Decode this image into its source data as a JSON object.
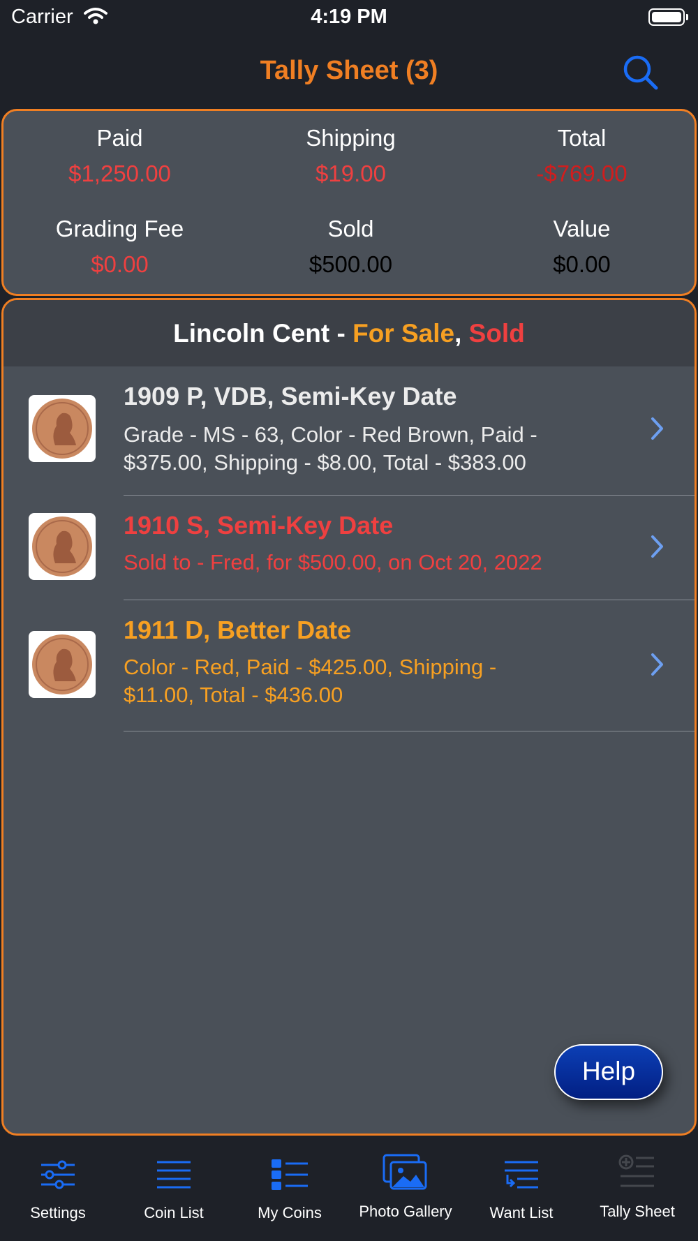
{
  "status_bar": {
    "carrier": "Carrier",
    "time": "4:19 PM"
  },
  "nav": {
    "title": "Tally Sheet (3)",
    "search_icon": "search-icon"
  },
  "summary": {
    "paid_label": "Paid",
    "paid_value": "$1,250.00",
    "shipping_label": "Shipping",
    "shipping_value": "$19.00",
    "total_label": "Total",
    "total_value": "-$769.00",
    "grading_label": "Grading Fee",
    "grading_value": "$0.00",
    "sold_label": "Sold",
    "sold_value": "$500.00",
    "value_label": "Value",
    "value_value": "$0.00"
  },
  "section": {
    "title": "Lincoln Cent - ",
    "for_sale": "For Sale",
    "comma": ", ",
    "sold": "Sold"
  },
  "coins": [
    {
      "title": "1909 P, VDB, Semi-Key Date",
      "line1": "Grade - MS - 63, Color - Red Brown, Paid -",
      "line2": "$375.00, Shipping - $8.00, Total - $383.00",
      "status_color": "#ececec"
    },
    {
      "title": "1910 S, Semi-Key Date",
      "line1": "Sold to - Fred, for $500.00, on Oct 20, 2022",
      "status_color": "#ef4040"
    },
    {
      "title": "1911 D, Better Date",
      "line1": "Color - Red, Paid - $425.00, Shipping -",
      "line2": "$11.00, Total - $436.00",
      "status_color": "#f7a022"
    }
  ],
  "help_button": "Help",
  "tabs": [
    {
      "label": "Settings",
      "icon": "sliders-icon"
    },
    {
      "label": "Coin List",
      "icon": "list-icon"
    },
    {
      "label": "My Coins",
      "icon": "grid-list-icon"
    },
    {
      "label": "Photo Gallery",
      "icon": "photos-icon"
    },
    {
      "label": "Want List",
      "icon": "want-list-icon"
    },
    {
      "label": "Tally Sheet",
      "icon": "tally-sheet-icon"
    }
  ],
  "colors": {
    "accent": "#f07f23",
    "tab_blue": "#1a6cf5",
    "card_bg": "#4a5058",
    "bar_bg": "#1e2128"
  }
}
